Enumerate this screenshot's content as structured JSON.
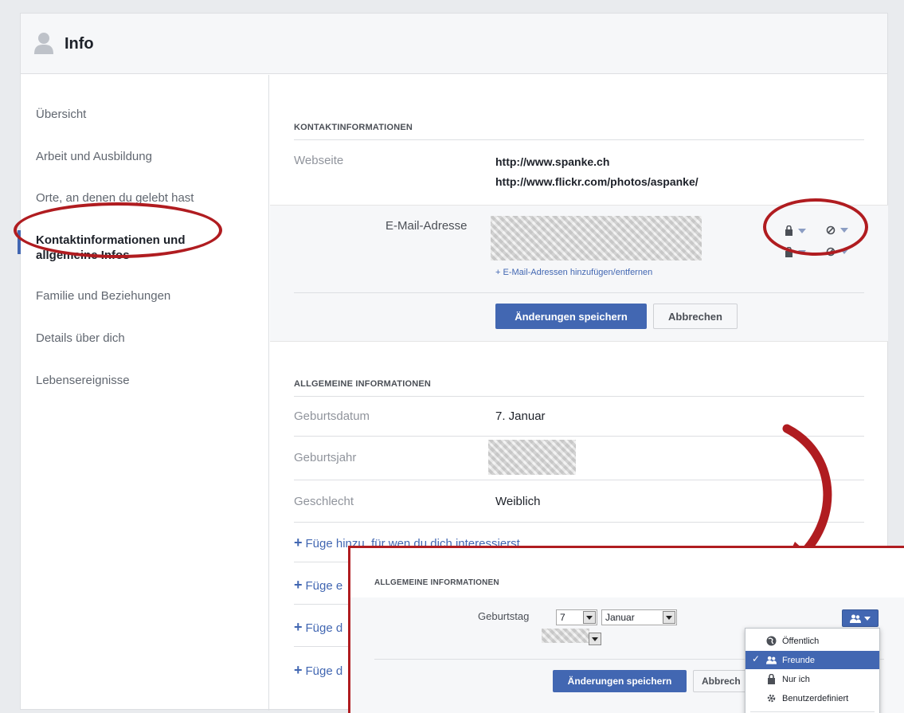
{
  "header": {
    "title": "Info",
    "icon": "person-icon"
  },
  "sidebar": {
    "items": [
      {
        "label": "Übersicht"
      },
      {
        "label": "Arbeit und Ausbildung"
      },
      {
        "label": "Orte, an denen du gelebt hast"
      },
      {
        "label_line1": "Kontaktinformationen und",
        "label_line2": "allgemeine Infos",
        "active": true
      },
      {
        "label": "Familie und Beziehungen"
      },
      {
        "label": "Details über dich"
      },
      {
        "label": "Lebensereignisse"
      }
    ]
  },
  "contact": {
    "section_title": "KONTAKTINFORMATIONEN",
    "website_label": "Webseite",
    "websites": [
      "http://www.spanke.ch",
      "http://www.flickr.com/photos/aspanke/"
    ],
    "email_label": "E-Mail-Adresse",
    "email_link": "+ E-Mail-Adressen hinzufügen/entfernen",
    "privacy_icons": [
      "lock-icon",
      "blocked-icon"
    ],
    "save_label": "Änderungen speichern",
    "cancel_label": "Abbrechen"
  },
  "general": {
    "section_title": "ALLGEMEINE INFORMATIONEN",
    "rows": [
      {
        "label": "Geburtsdatum",
        "value": "7. Januar"
      },
      {
        "label": "Geburtsjahr",
        "value": ""
      },
      {
        "label": "Geschlecht",
        "value": "Weiblich"
      }
    ],
    "add_links": [
      "Füge hinzu, für wen du dich interessierst",
      "Füge e",
      "Füge d",
      "Füge d"
    ]
  },
  "inset": {
    "section_title": "ALLGEMEINE INFORMATIONEN",
    "birthday_label": "Geburtstag",
    "day_value": "7",
    "month_value": "Januar",
    "save_label": "Änderungen speichern",
    "cancel_label": "Abbrech",
    "audience_menu": [
      {
        "label": "Öffentlich",
        "icon": "globe-icon",
        "selected": false
      },
      {
        "label": "Freunde",
        "icon": "friends-icon",
        "selected": true
      },
      {
        "label": "Nur ich",
        "icon": "lock-icon",
        "selected": false
      },
      {
        "label": "Benutzerdefiniert",
        "icon": "gear-icon",
        "selected": false
      }
    ],
    "check_mark": "✓"
  },
  "colors": {
    "accent": "#4267b2",
    "annotation_red": "#b01c20"
  }
}
